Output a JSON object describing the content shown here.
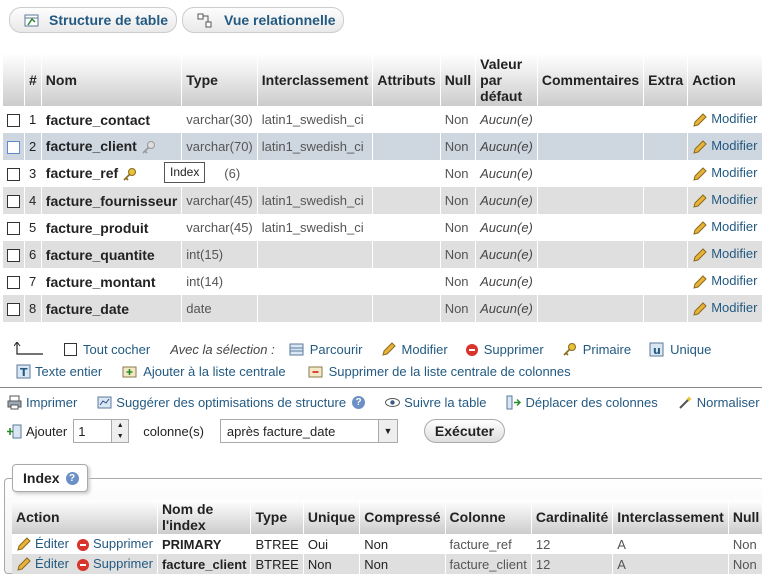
{
  "tabs": {
    "structure": "Structure de table",
    "relational": "Vue relationnelle"
  },
  "columns_header": {
    "hash": "#",
    "name": "Nom",
    "type": "Type",
    "collation": "Interclassement",
    "attributes": "Attributs",
    "null": "Null",
    "default_line1": "Valeur",
    "default_line2": "par",
    "default_line3": "défaut",
    "comments": "Commentaires",
    "extra": "Extra",
    "action": "Action"
  },
  "rows": [
    {
      "num": "1",
      "name": "facture_contact",
      "type": "varchar(30)",
      "collation": "latin1_swedish_ci",
      "null": "Non",
      "default": "Aucun(e)",
      "action": "Modifier"
    },
    {
      "num": "2",
      "name": "facture_client",
      "type": "varchar(70)",
      "collation": "latin1_swedish_ci",
      "null": "Non",
      "default": "Aucun(e)",
      "action": "Modifier"
    },
    {
      "num": "3",
      "name": "facture_ref",
      "type": "(6)",
      "collation": "",
      "null": "Non",
      "default": "Aucun(e)",
      "action": "Modifier"
    },
    {
      "num": "4",
      "name": "facture_fournisseur",
      "type": "varchar(45)",
      "collation": "latin1_swedish_ci",
      "null": "Non",
      "default": "Aucun(e)",
      "action": "Modifier"
    },
    {
      "num": "5",
      "name": "facture_produit",
      "type": "varchar(45)",
      "collation": "latin1_swedish_ci",
      "null": "Non",
      "default": "Aucun(e)",
      "action": "Modifier"
    },
    {
      "num": "6",
      "name": "facture_quantite",
      "type": "int(15)",
      "collation": "",
      "null": "Non",
      "default": "Aucun(e)",
      "action": "Modifier"
    },
    {
      "num": "7",
      "name": "facture_montant",
      "type": "int(14)",
      "collation": "",
      "null": "Non",
      "default": "Aucun(e)",
      "action": "Modifier"
    },
    {
      "num": "8",
      "name": "facture_date",
      "type": "date",
      "collation": "",
      "null": "Non",
      "default": "Aucun(e)",
      "action": "Modifier"
    }
  ],
  "tooltip": "Index",
  "selection": {
    "check_all": "Tout cocher",
    "with_selection": "Avec la sélection :",
    "browse": "Parcourir",
    "modify": "Modifier",
    "delete": "Supprimer",
    "primary": "Primaire",
    "unique": "Unique",
    "full_text": "Texte entier",
    "add_central": "Ajouter à la liste centrale",
    "remove_central": "Supprimer de la liste centrale de colonnes"
  },
  "toolbar": {
    "print": "Imprimer",
    "suggest": "Suggérer des optimisations de structure",
    "track": "Suivre la table",
    "move": "Déplacer des colonnes",
    "normalize": "Normaliser"
  },
  "add_row": {
    "add": "Ajouter",
    "count": "1",
    "columns": "colonne(s)",
    "position": "après facture_date",
    "execute": "Exécuter"
  },
  "index": {
    "legend": "Index",
    "headers": [
      "Action",
      "Nom de l'index",
      "Type",
      "Unique",
      "Compressé",
      "Colonne",
      "Cardinalité",
      "Interclassement",
      "Null"
    ],
    "edit": "Éditer",
    "delete": "Supprimer",
    "rows": [
      {
        "name": "PRIMARY",
        "type": "BTREE",
        "unique": "Oui",
        "packed": "Non",
        "column": "facture_ref",
        "cardinality": "12",
        "collation": "A",
        "null": "Non"
      },
      {
        "name": "facture_client",
        "type": "BTREE",
        "unique": "Non",
        "packed": "Non",
        "column": "facture_client",
        "cardinality": "12",
        "collation": "A",
        "null": "Non"
      }
    ]
  }
}
